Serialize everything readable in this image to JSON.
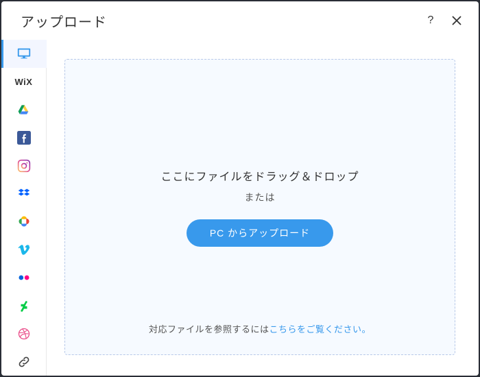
{
  "header": {
    "title": "アップロード",
    "help_label": "?",
    "close_label": "×"
  },
  "sidebar": {
    "items": [
      {
        "id": "computer",
        "label": "My Computer",
        "active": true
      },
      {
        "id": "wix",
        "label": "WiX"
      },
      {
        "id": "gdrive",
        "label": "Google Drive"
      },
      {
        "id": "facebook",
        "label": "Facebook"
      },
      {
        "id": "instagram",
        "label": "Instagram"
      },
      {
        "id": "dropbox",
        "label": "Dropbox"
      },
      {
        "id": "gphotos",
        "label": "Google Photos"
      },
      {
        "id": "vimeo",
        "label": "Vimeo"
      },
      {
        "id": "flickr",
        "label": "Flickr"
      },
      {
        "id": "deviantart",
        "label": "DeviantArt"
      },
      {
        "id": "dribbble",
        "label": "Dribbble"
      },
      {
        "id": "url",
        "label": "URL"
      }
    ]
  },
  "dropzone": {
    "drag_text": "ここにファイルをドラッグ＆ドロップ",
    "or_text": "または",
    "upload_button": "PC からアップロード",
    "footer_prefix": "対応ファイルを参照するには",
    "footer_link": "こちらをご覧ください。"
  },
  "colors": {
    "accent": "#3899ec"
  }
}
